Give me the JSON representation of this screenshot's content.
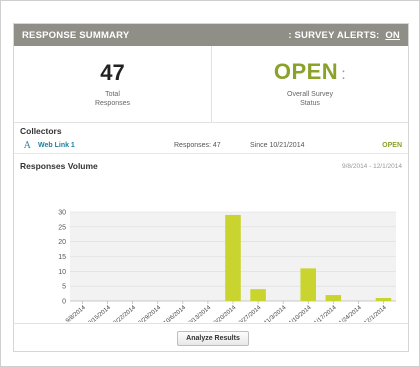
{
  "header": {
    "title": "RESPONSE SUMMARY",
    "alerts_label": ": SURVEY ALERTS:",
    "alerts_state": "ON"
  },
  "stats": {
    "total": {
      "value": "47",
      "label_line1": "Total",
      "label_line2": "Responses"
    },
    "status": {
      "value": "OPEN",
      "suffix": ":",
      "label_line1": "Overall Survey",
      "label_line2": "Status"
    }
  },
  "collectors": {
    "title": "Collectors",
    "items": [
      {
        "icon": "web-link-icon",
        "glyph": "A",
        "name": "Web Link 1",
        "responses": "Responses: 47",
        "since": "Since 10/21/2014",
        "status": "OPEN"
      }
    ]
  },
  "volume": {
    "title": "Responses Volume",
    "range": "9/8/2014 - 12/1/2014"
  },
  "chart_data": {
    "type": "bar",
    "categories": [
      "9/8/2014",
      "9/15/2014",
      "9/22/2014",
      "9/29/2014",
      "10/6/2014",
      "10/13/2014",
      "10/20/2014",
      "10/27/2014",
      "11/3/2014",
      "11/10/2014",
      "11/17/2014",
      "11/24/2014",
      "12/1/2014"
    ],
    "values": [
      0,
      0,
      0,
      0,
      0,
      0,
      29,
      4,
      0,
      11,
      2,
      0,
      1
    ],
    "ylim": [
      0,
      30
    ],
    "yticks": [
      "0",
      "5",
      "10",
      "15",
      "20",
      "25",
      "30"
    ],
    "bar_color": "#c9d42e",
    "grid": true
  },
  "footer": {
    "analyze_label": "Analyze Results"
  }
}
